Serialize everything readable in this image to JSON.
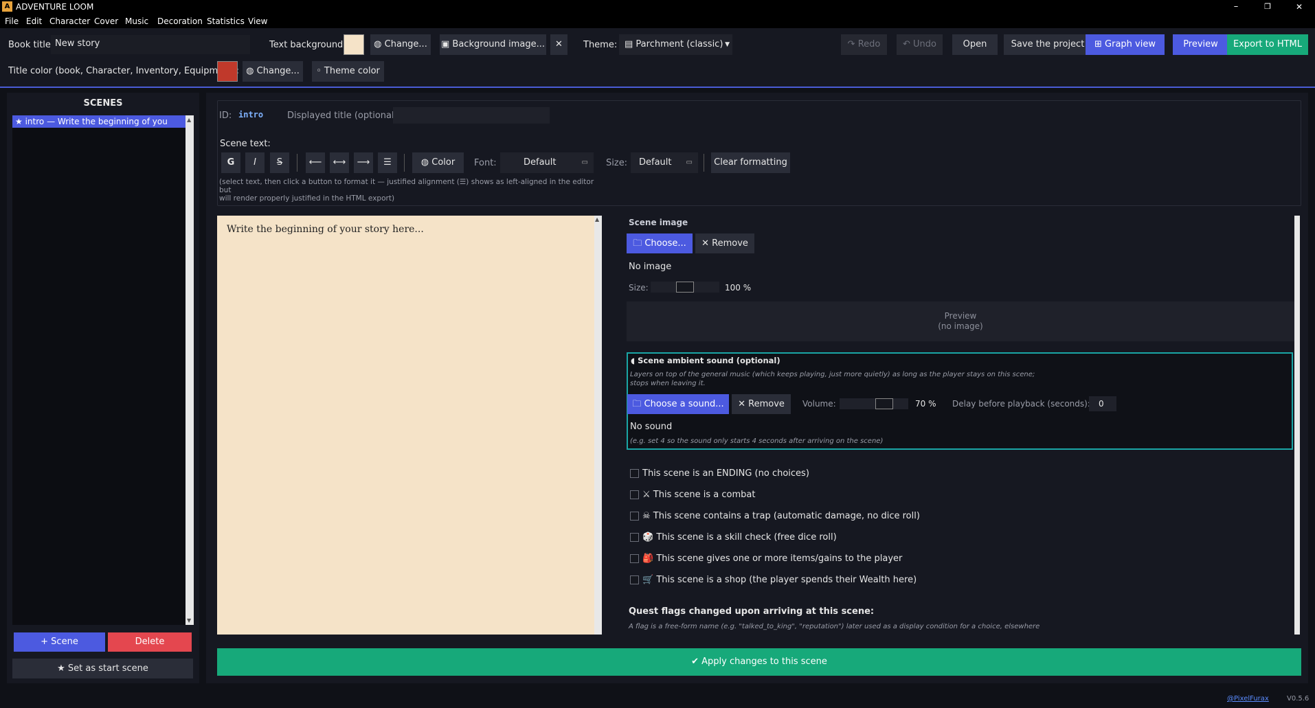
{
  "window": {
    "title": "ADVENTURE LOOM",
    "app_icon": "A",
    "minimize": "–",
    "restore": "❐",
    "close": "✕"
  },
  "menu": [
    "File",
    "Edit",
    "Character",
    "Cover",
    "Music",
    "Decoration",
    "Statistics",
    "View"
  ],
  "toolbar": {
    "book_title_label": "Book title:",
    "book_title_value": "New story",
    "text_bg_label": "Text background:",
    "text_bg_color": "#f5e3c8",
    "change_label": "Change...",
    "bg_image_label": "Background image...",
    "clear_bg": "✕",
    "theme_label": "Theme:",
    "theme_value": "Parchment (classic)",
    "redo": "Redo",
    "undo": "Undo",
    "open": "Open",
    "save": "Save the project",
    "graph": "Graph view",
    "preview": "Preview",
    "export": "Export to HTML",
    "title_color_label": "Title color (book, Character, Inventory, Equipment):",
    "title_color": "#c0392b",
    "change2_label": "Change...",
    "theme_color_label": "Theme color"
  },
  "scenes": {
    "header": "SCENES",
    "items": [
      {
        "label": "intro — Write the beginning of you",
        "start": "★"
      }
    ],
    "add": "+ Scene",
    "delete": "Delete",
    "set_start": "★  Set as start scene"
  },
  "editor": {
    "id_label": "ID:",
    "id_value": "intro",
    "displayed_title_label": "Displayed title (optional):",
    "scene_text_label": "Scene text:",
    "fmt_bold": "G",
    "fmt_italic": "I",
    "fmt_strike": "S",
    "align_left": "⟵",
    "align_center": "⟷",
    "align_right": "⟶",
    "align_justify": "☰",
    "color_label": "Color",
    "font_label": "Font:",
    "font_value": "Default",
    "size_label": "Size:",
    "size_value": "Default",
    "clear_formatting": "Clear formatting",
    "hint_line1": "(select text, then click a button to format it — justified alignment (☰) shows as left-aligned in the editor but",
    "hint_line2": "will render properly justified in the HTML export)",
    "text_content": "Write the beginning of your story here..."
  },
  "scene_image": {
    "title": "Scene image",
    "choose": "Choose...",
    "remove": "Remove",
    "status": "No image",
    "size_label": "Size:",
    "size_value": "100 %",
    "preview_line1": "Preview",
    "preview_line2": "(no image)"
  },
  "ambient": {
    "title": "Scene ambient sound (optional)",
    "desc1": "Layers on top of the general music (which keeps playing, just more quietly) as long as the player stays on this scene;",
    "desc2": "stops when leaving it.",
    "choose": "Choose a sound...",
    "remove": "Remove",
    "volume_label": "Volume:",
    "volume_value": "70 %",
    "delay_label": "Delay before playback (seconds):",
    "delay_value": "0",
    "status": "No sound",
    "hint": "(e.g. set 4 so the sound only starts 4 seconds after arriving on the scene)"
  },
  "options": [
    {
      "icon": "",
      "label": "This scene is an ENDING (no choices)"
    },
    {
      "icon": "⚔",
      "label": "This scene is a combat"
    },
    {
      "icon": "☠",
      "label": "This scene contains a trap (automatic damage, no dice roll)"
    },
    {
      "icon": "🎲",
      "label": "This scene is a skill check (free dice roll)"
    },
    {
      "icon": "🎒",
      "label": "This scene gives one or more items/gains to the player"
    },
    {
      "icon": "🛒",
      "label": "This scene is a shop (the player spends their Wealth here)"
    }
  ],
  "quest": {
    "title": "Quest flags changed upon arriving at this scene:",
    "desc": "A flag is a free-form name (e.g. \"talked_to_king\", \"reputation\") later used as a display condition for a choice, elsewhere"
  },
  "apply": "✔  Apply changes to this scene",
  "footer": {
    "link": "@PixelFurax",
    "version": "V0.5.6"
  }
}
